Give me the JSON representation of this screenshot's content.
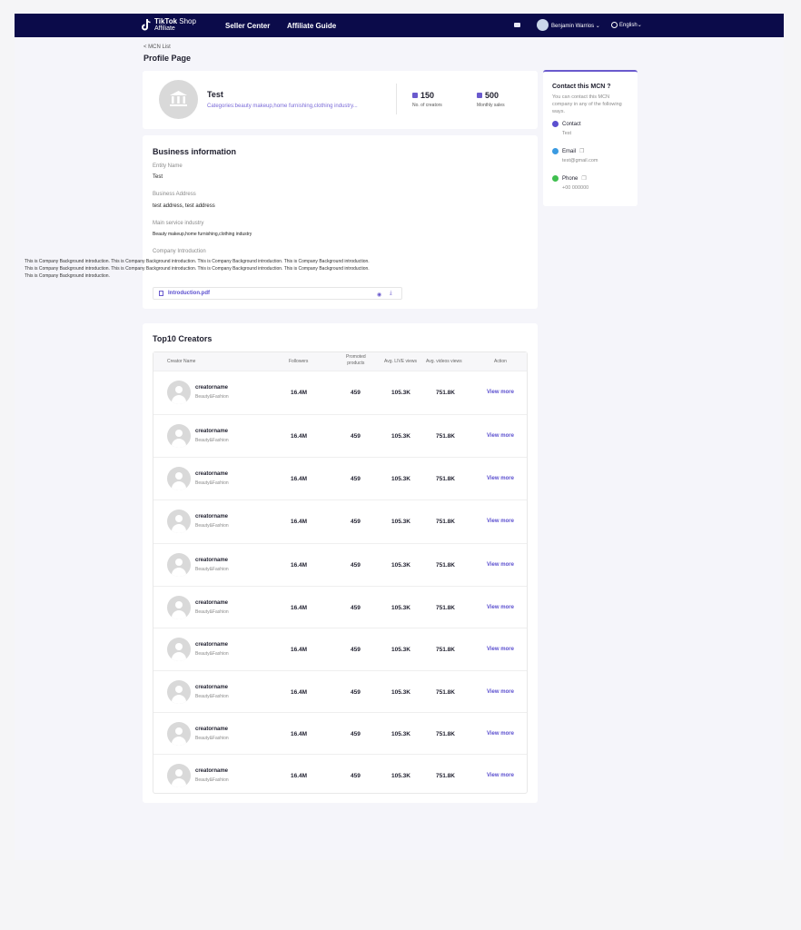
{
  "nav": {
    "logo_line1_bold": "TikTok",
    "logo_line1_rest": " Shop",
    "logo_line2": "Affiliate",
    "seller_center": "Seller Center",
    "affiliate_guide": "Affiliate Guide",
    "user_name": "Benjamin Warrios",
    "language": "English"
  },
  "breadcrumb": "< MCN List",
  "page_title": "Profile Page",
  "profile": {
    "name": "Test",
    "categories": "Categories:beauty makeup,home furnishing,clothing industry...",
    "creators_count": "150",
    "creators_label": "No. of creators",
    "sales_count": "500",
    "sales_label": "Monthly sales"
  },
  "business": {
    "title": "Business information",
    "entity_label": "Entity Name",
    "entity_value": "Test",
    "address_label": "Business Address",
    "address_value": "test address, test address",
    "industry_label": "Main service industry",
    "industry_value": "Beauty makeup,home furnishing,clothing industry",
    "intro_label": "Company Introduction",
    "intro_lines": [
      "This is  Company Background introduction. This is  Company Background introduction. This is  Company Background introduction. This is  Company Background introduction.",
      "This is  Company Background introduction. This is  Company Background introduction. This is  Company Background introduction. This is  Company Background introduction.",
      "This is  Company Background introduction."
    ],
    "file_name": "Introduction.pdf"
  },
  "contact": {
    "title": "Contact this MCN ?",
    "desc": "You can contact this MCN company in any of the following ways.",
    "contact_label": "Contact",
    "contact_value": "Test",
    "email_label": "Email",
    "email_value": "test@gmail.com",
    "phone_label": "Phone",
    "phone_value": "+00 000000"
  },
  "creators": {
    "title": "Top10 Creators",
    "headers": {
      "name": "Creator Name",
      "followers": "Followers",
      "promoted1": "Promoted",
      "promoted2": "products",
      "live": "Avg. LIVE views",
      "video": "Avg. videos views",
      "action": "Action"
    },
    "rows": [
      {
        "name": "creatorname",
        "category": "Beauty&Fashion",
        "followers": "16.4M",
        "promoted": "459",
        "live": "105.3K",
        "video": "751.8K",
        "action": "View more"
      },
      {
        "name": "creatorname",
        "category": "Beauty&Fashion",
        "followers": "16.4M",
        "promoted": "459",
        "live": "105.3K",
        "video": "751.8K",
        "action": "View more"
      },
      {
        "name": "creatorname",
        "category": "Beauty&Fashion",
        "followers": "16.4M",
        "promoted": "459",
        "live": "105.3K",
        "video": "751.8K",
        "action": "View more"
      },
      {
        "name": "creatorname",
        "category": "Beauty&Fashion",
        "followers": "16.4M",
        "promoted": "459",
        "live": "105.3K",
        "video": "751.8K",
        "action": "View more"
      },
      {
        "name": "creatorname",
        "category": "Beauty&Fashion",
        "followers": "16.4M",
        "promoted": "459",
        "live": "105.3K",
        "video": "751.8K",
        "action": "View more"
      },
      {
        "name": "creatorname",
        "category": "Beauty&Fashion",
        "followers": "16.4M",
        "promoted": "459",
        "live": "105.3K",
        "video": "751.8K",
        "action": "View more"
      },
      {
        "name": "creatorname",
        "category": "Beauty&Fashion",
        "followers": "16.4M",
        "promoted": "459",
        "live": "105.3K",
        "video": "751.8K",
        "action": "View more"
      },
      {
        "name": "creatorname",
        "category": "Beauty&Fashion",
        "followers": "16.4M",
        "promoted": "459",
        "live": "105.3K",
        "video": "751.8K",
        "action": "View more"
      },
      {
        "name": "creatorname",
        "category": "Beauty&Fashion",
        "followers": "16.4M",
        "promoted": "459",
        "live": "105.3K",
        "video": "751.8K",
        "action": "View more"
      },
      {
        "name": "creatorname",
        "category": "Beauty&Fashion",
        "followers": "16.4M",
        "promoted": "459",
        "live": "105.3K",
        "video": "751.8K",
        "action": "View more"
      }
    ]
  }
}
